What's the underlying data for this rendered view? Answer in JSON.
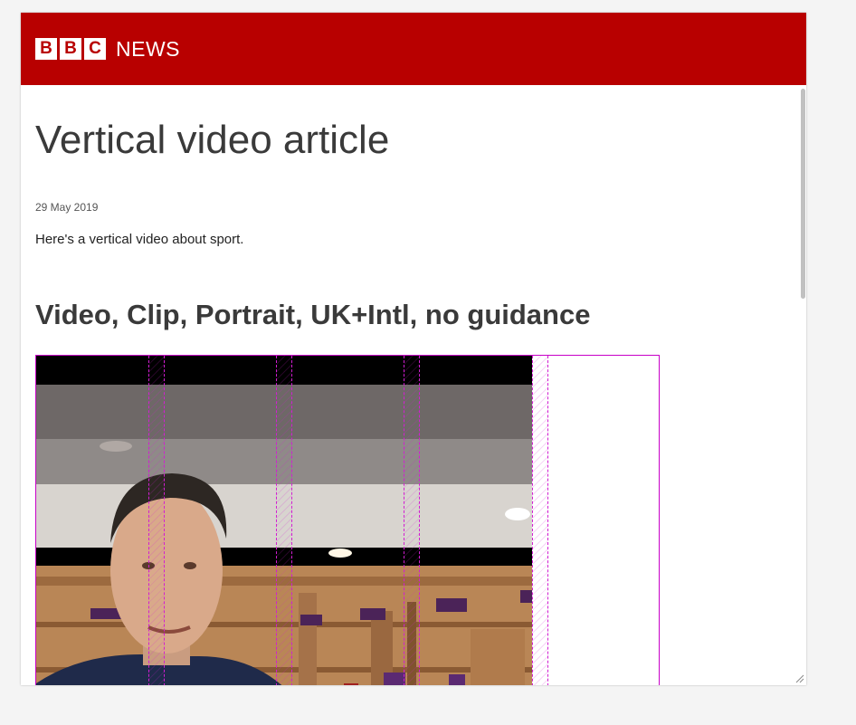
{
  "brand": {
    "letters": [
      "B",
      "B",
      "C"
    ],
    "section": "NEWS",
    "bar_color": "#b80000"
  },
  "article": {
    "title": "Vertical video article",
    "date": "29 May 2019",
    "intro": "Here's a vertical video about sport.",
    "media_heading": "Video, Clip, Portrait, UK+Intl, no guidance"
  },
  "media": {
    "kind": "vertical video player",
    "guide_color": "#c800c8"
  },
  "icons": {
    "resize": "resize-grip-icon"
  }
}
